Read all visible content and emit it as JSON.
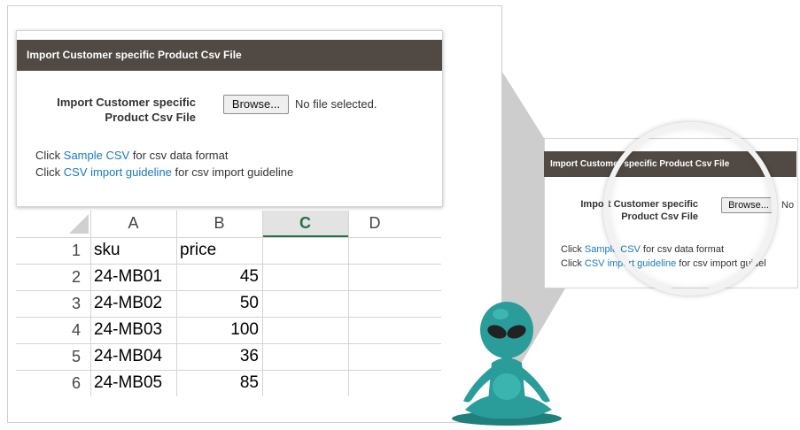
{
  "panel": {
    "header_title": "Import Customer specific Product Csv File",
    "field_label_line1": "Import Customer specific",
    "field_label_line2": "Product Csv File",
    "browse_label": "Browse...",
    "file_status": "No file selected.",
    "help_line1": {
      "prefix": "Click ",
      "link": "Sample CSV",
      "suffix": " for csv data format"
    },
    "help_line2": {
      "prefix": "Click ",
      "link": "CSV import guideline",
      "suffix": " for csv import guideline"
    }
  },
  "spreadsheet": {
    "columns": [
      "A",
      "B",
      "C",
      "D"
    ],
    "active_column": "C",
    "rows": [
      {
        "num": "1",
        "a": "sku",
        "b": "price"
      },
      {
        "num": "2",
        "a": "24-MB01",
        "b": "45"
      },
      {
        "num": "3",
        "a": "24-MB02",
        "b": "50"
      },
      {
        "num": "4",
        "a": "24-MB03",
        "b": "100"
      },
      {
        "num": "5",
        "a": "24-MB04",
        "b": "36"
      },
      {
        "num": "6",
        "a": "24-MB05",
        "b": "85"
      }
    ]
  },
  "zoom": {
    "header_title": "Import Customer specific Product Csv File",
    "field_label_line1": "Import Customer specific",
    "field_label_line2": "Product Csv File",
    "browse_label": "Browse...",
    "file_status_partial": "No",
    "help_line1": {
      "prefix": "Click ",
      "link": "Sample CSV",
      "suffix": " for csv data format"
    },
    "help_line2": {
      "prefix": "Click ",
      "link": "CSV import guideline",
      "suffix": " for csv import guidel"
    }
  },
  "colors": {
    "header_bg": "#514943",
    "link": "#1979c3",
    "active_column": "#217346",
    "mascot": "#2a9d9a",
    "wedge": "#cfcfcf"
  },
  "icons": {
    "mascot": "alien-meditating-mascot-icon"
  }
}
